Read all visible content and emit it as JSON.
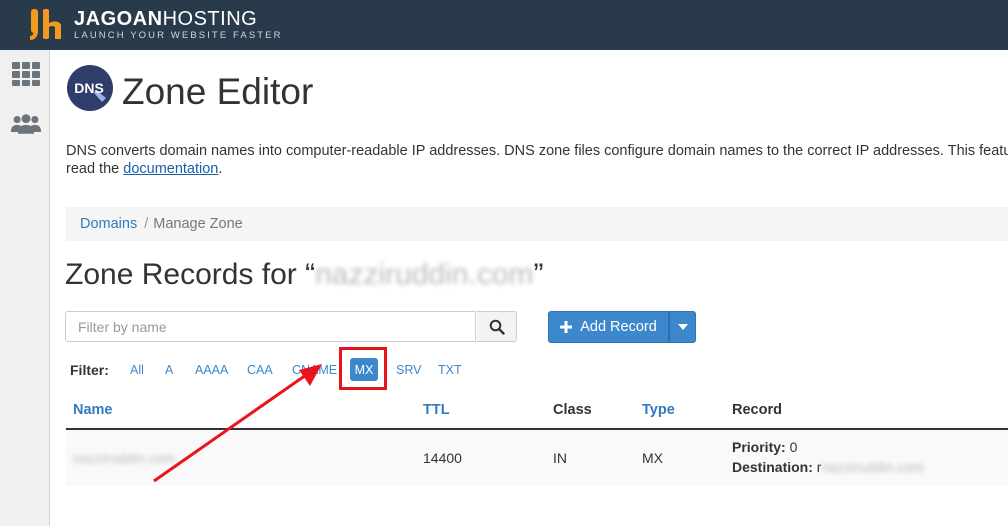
{
  "brand": {
    "name_bold": "JAGOAN",
    "name_light": "HOSTING",
    "tagline": "LAUNCH YOUR WEBSITE FASTER",
    "accent_color": "#f29a1f",
    "topbar_color": "#293a4a"
  },
  "sidebar": {
    "items": [
      {
        "icon": "grid-icon"
      },
      {
        "icon": "users-icon"
      }
    ]
  },
  "page": {
    "title": "Zone Editor",
    "icon_text": "DNS",
    "description_line1": "DNS converts domain names into computer-readable IP addresses. DNS zone files configure domain names to the correct IP addresses. This featu",
    "description_line2_prefix": "read the ",
    "description_link": "documentation",
    "description_line2_suffix": "."
  },
  "breadcrumb": {
    "link": "Domains",
    "separator": "/",
    "current": "Manage Zone"
  },
  "zone": {
    "title_prefix": "Zone Records for “",
    "domain_blurred": "nazziruddin.com",
    "title_suffix": "”"
  },
  "search": {
    "placeholder": "Filter by name"
  },
  "actions": {
    "add_record_label": "Add Record"
  },
  "filter": {
    "label": "Filter:",
    "options": [
      "All",
      "A",
      "AAAA",
      "CAA",
      "CNAME",
      "MX",
      "SRV",
      "TXT"
    ],
    "active": "MX"
  },
  "table": {
    "headers": {
      "name": "Name",
      "ttl": "TTL",
      "class": "Class",
      "type": "Type",
      "record": "Record"
    },
    "rows": [
      {
        "name_blurred": "nazziruddin.com",
        "name_suffix": "",
        "ttl": "14400",
        "class": "IN",
        "type": "MX",
        "priority_label": "Priority:",
        "priority_value": "0",
        "destination_label": "Destination:",
        "destination_prefix": "r",
        "destination_blurred": "nazziruddin.com"
      }
    ]
  }
}
